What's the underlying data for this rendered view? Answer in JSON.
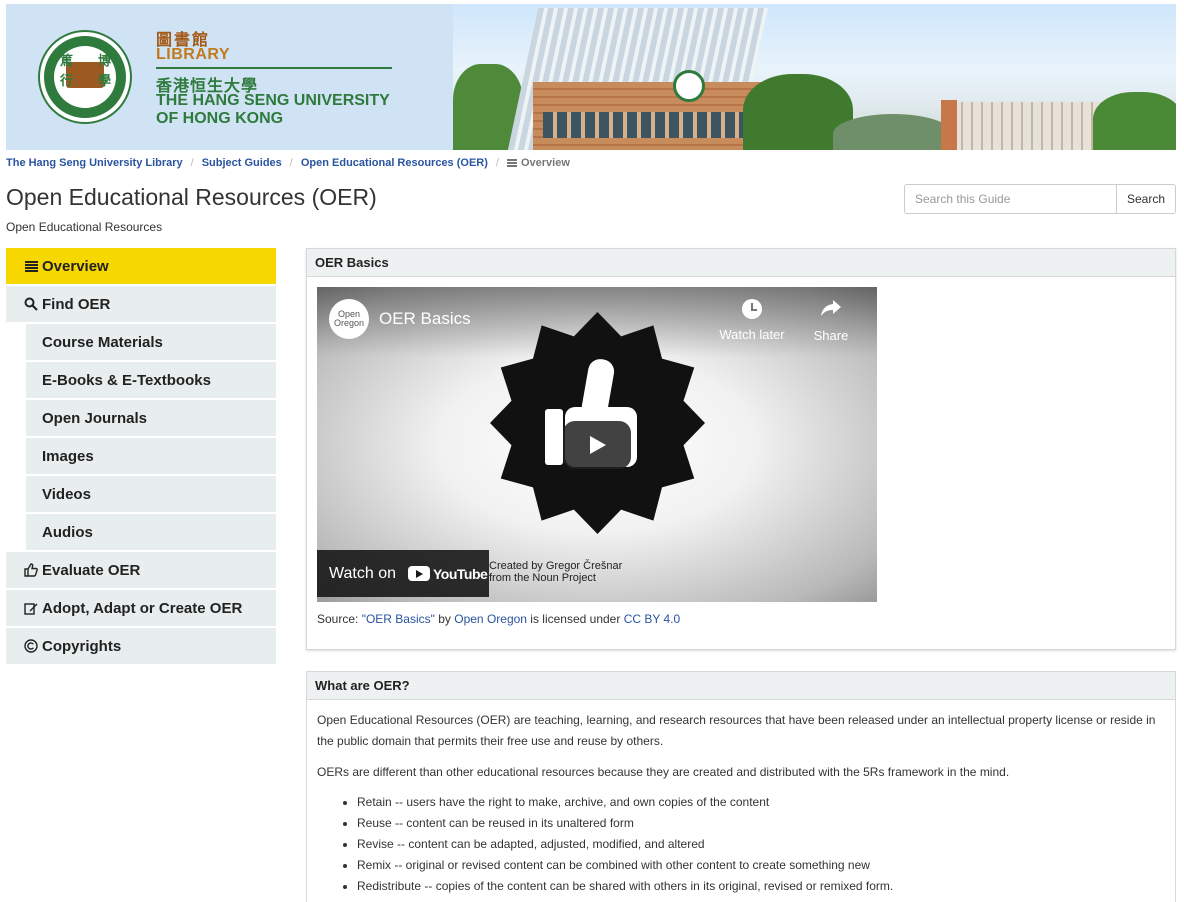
{
  "banner": {
    "seal_chars": [
      "篤",
      "博",
      "行",
      "學"
    ],
    "chinese_library": "圖書館",
    "library": "LIBRARY",
    "chinese_university": "香港恒生大學",
    "university_line1": "THE HANG SENG UNIVERSITY",
    "university_line2": "OF HONG KONG"
  },
  "breadcrumb": {
    "items": [
      "The Hang Seng University Library",
      "Subject Guides",
      "Open Educational Resources (OER)"
    ],
    "current": "Overview",
    "separator": "/"
  },
  "page": {
    "title": "Open Educational Resources (OER)",
    "subtitle": "Open Educational Resources"
  },
  "search": {
    "placeholder": "Search this Guide",
    "button": "Search"
  },
  "sidebar": {
    "items": [
      {
        "label": "Overview",
        "icon": "list-icon"
      },
      {
        "label": "Find OER",
        "icon": "search-icon"
      },
      {
        "label": "Course Materials"
      },
      {
        "label": "E-Books & E-Textbooks"
      },
      {
        "label": "Open Journals"
      },
      {
        "label": "Images"
      },
      {
        "label": "Videos"
      },
      {
        "label": "Audios"
      },
      {
        "label": "Evaluate OER",
        "icon": "thumbs-up-icon"
      },
      {
        "label": "Adopt, Adapt or Create OER",
        "icon": "edit-icon"
      },
      {
        "label": "Copyrights",
        "icon": "copyright-icon"
      }
    ]
  },
  "panel_basics": {
    "heading": "OER Basics",
    "video": {
      "channel": "Open Oregon",
      "title": "OER Basics",
      "watch_later": "Watch later",
      "share": "Share",
      "credit_line1": "Created by Gregor Črešnar",
      "credit_line2": "from the Noun Project",
      "watch_on": "Watch on",
      "youtube": "YouTube"
    },
    "source": {
      "prefix": "Source: ",
      "work": "\"OER Basics\"",
      "by": " by ",
      "author": "Open Oregon",
      "licensed": " is licensed under ",
      "license": "CC BY 4.0"
    }
  },
  "panel_what": {
    "heading": "What are OER?",
    "para1": "Open Educational Resources (OER) are teaching, learning, and research resources that have been released under an intellectual property license or reside in the public domain that permits their free use and reuse by others.",
    "para2": "OERs are different than other educational resources because they are created and distributed with the 5Rs framework in the mind.",
    "bullets": [
      "Retain -- users have the right to make, archive, and own copies of the content",
      "Reuse -- content can be reused in its unaltered form",
      "Revise -- content can be adapted, adjusted, modified, and altered",
      "Remix -- original or revised content can be combined with other content to create something new",
      "Redistribute -- copies of the content can be shared with others in its original, revised or remixed form."
    ]
  },
  "colors": {
    "active_nav": "#f7d700",
    "nav_bg": "#e8eeee",
    "link": "#2a54a0",
    "brand_green": "#2f7a3d"
  }
}
